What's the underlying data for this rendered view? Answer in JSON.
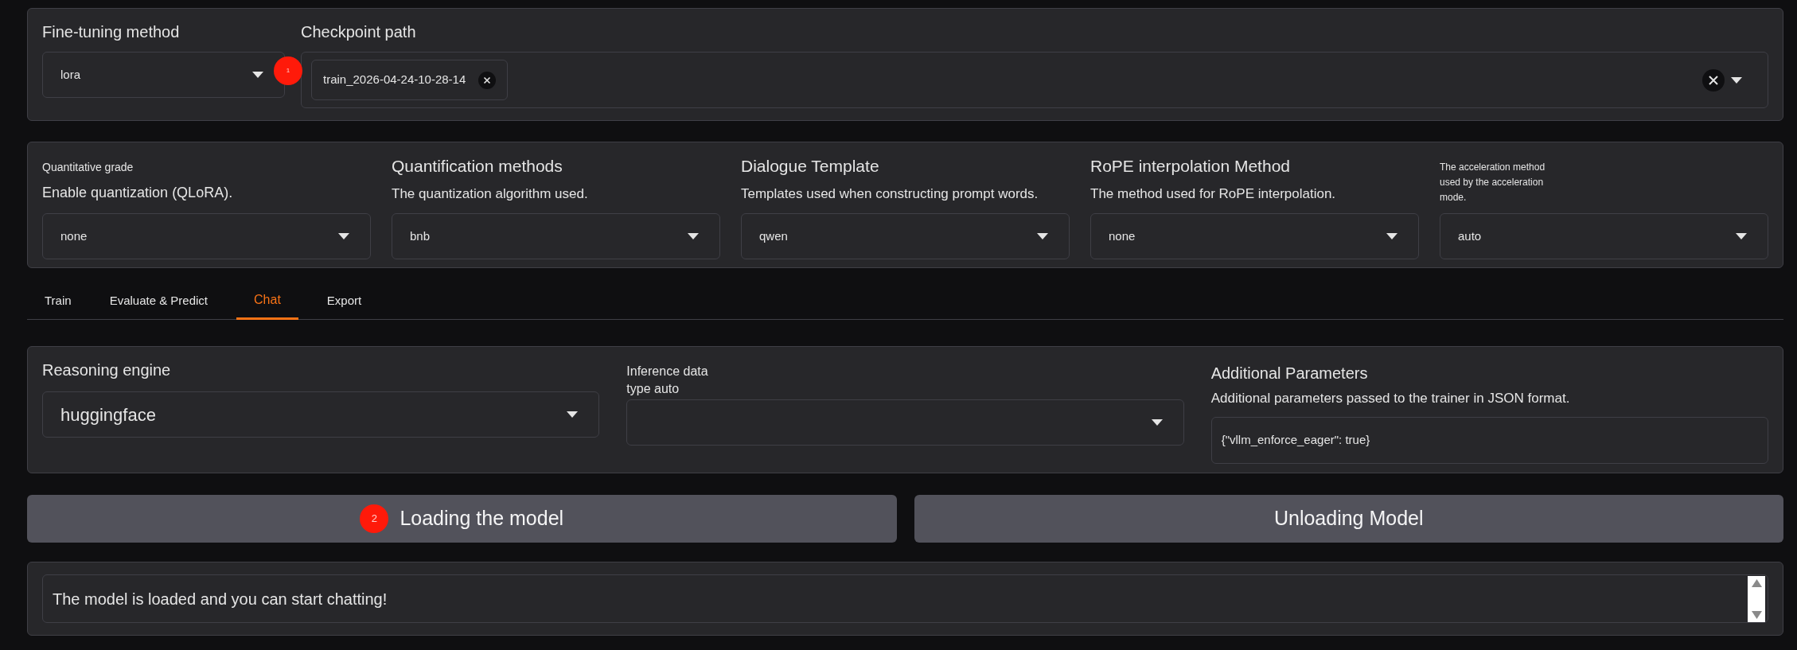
{
  "top_panel": {
    "method": {
      "label": "Fine-tuning method",
      "value": "lora"
    },
    "marker": {
      "label": "1"
    },
    "checkpoint": {
      "label": "Checkpoint path",
      "chips": [
        "train_2026-04-24-10-28-14"
      ]
    }
  },
  "settings": [
    {
      "kind": "small",
      "label": "Quantitative grade",
      "info": "Enable quantization (QLoRA).",
      "value": "none"
    },
    {
      "kind": "large",
      "label": "Quantification methods",
      "info": "The quantization algorithm used.",
      "value": "bnb"
    },
    {
      "kind": "large",
      "label": "Dialogue Template",
      "info": "Templates used when constructing prompt words.",
      "value": "qwen"
    },
    {
      "kind": "large",
      "label": "RoPE interpolation Method",
      "info": "The method used for RoPE interpolation.",
      "value": "none"
    },
    {
      "kind": "note",
      "label": "The acceleration method used by the acceleration mode.",
      "value": "auto"
    }
  ],
  "tabs": [
    {
      "label": "Train",
      "selected": false
    },
    {
      "label": "Evaluate & Predict",
      "selected": false
    },
    {
      "label": "Chat",
      "selected": true
    },
    {
      "label": "Export",
      "selected": false
    }
  ],
  "chat_panel": {
    "engine": {
      "label": "Reasoning engine",
      "value": "huggingface"
    },
    "dtype": {
      "label": "Inference data type auto"
    },
    "extra": {
      "label": "Additional Parameters",
      "info": "Additional parameters passed to the trainer in JSON format.",
      "value": "{\"vllm_enforce_eager\": true}"
    }
  },
  "buttons": [
    {
      "label": "Loading the model",
      "badge": "2"
    },
    {
      "label": "Unloading Model"
    }
  ],
  "output": {
    "text": "The model is loaded and you can start chatting!"
  }
}
